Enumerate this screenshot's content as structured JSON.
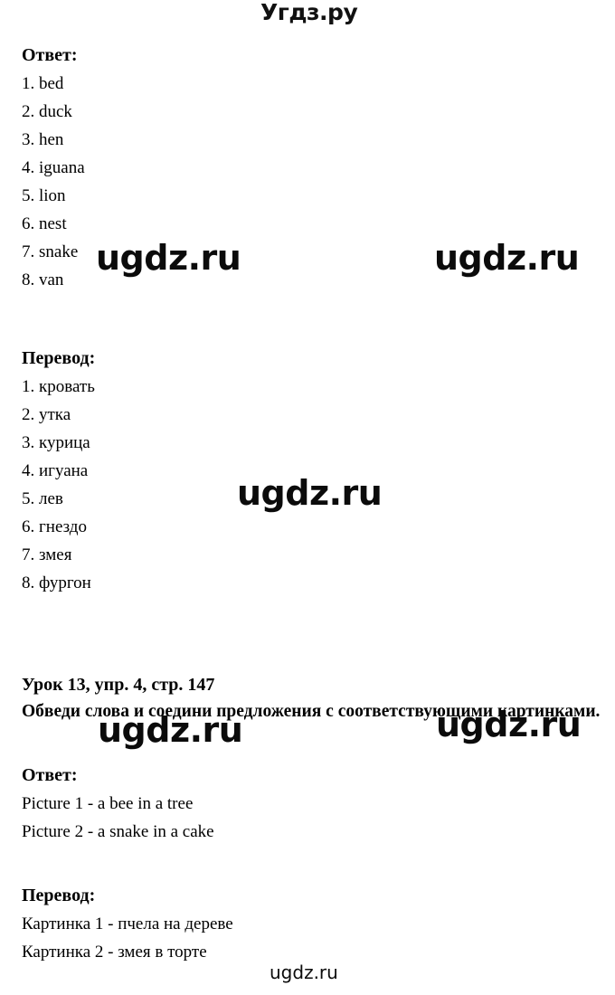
{
  "site": {
    "logo_text": "Угдз.ру",
    "watermark_text": "ugdz.ru"
  },
  "exercise_a": {
    "answer_heading": "Ответ:",
    "answer_items": [
      "1. bed",
      "2. duck",
      "3. hen",
      "4. iguana",
      "5. lion",
      "6. nest",
      "7. snake",
      "8. van"
    ],
    "translation_heading": "Перевод:",
    "translation_items": [
      "1. кровать",
      "2. утка",
      "3. курица",
      "4. игуана",
      "5. лев",
      "6. гнездо",
      "7. змея",
      "8. фургон"
    ]
  },
  "exercise_b": {
    "title": "Урок 13, упр. 4, стр. 147",
    "prompt": "Обведи слова и соедини предложения с соответствующими картинками.",
    "answer_heading": "Ответ:",
    "answer_lines": [
      "Picture 1 - a bee in a tree",
      "Picture 2 - a snake in a cake"
    ],
    "translation_heading": "Перевод:",
    "translation_lines": [
      "Картинка 1 - пчела на дереве",
      "Картинка 2 - змея в торте"
    ]
  },
  "colors": {
    "background": "#ffffff",
    "text": "#000000",
    "watermark": "#0b0b0b"
  }
}
